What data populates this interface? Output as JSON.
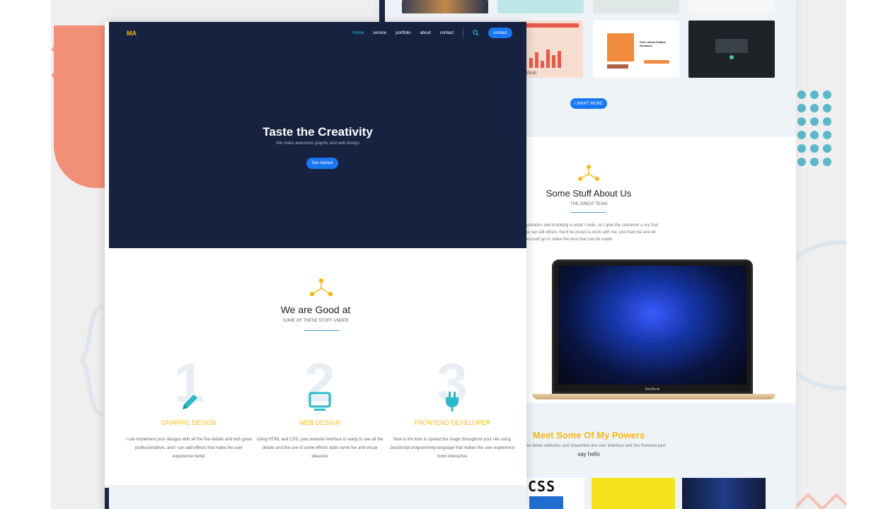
{
  "colors": {
    "navy": "#172240",
    "accent_blue": "#1877f2",
    "yellow": "#f5b915",
    "teal": "#2bb8c9",
    "coral": "#f28f77"
  },
  "back_page": {
    "thumbs": {
      "chair_title": "Full Limited Edition Sneakers",
      "price": "$478.00"
    },
    "want_more_label": "I WANT MORE",
    "about": {
      "title": "Some Stuff About Us",
      "subtitle": "THE GREAT TEAM",
      "text": "eputation and branding is what I seek, so I give the customer a ory that he can tell others You'll be proud to work with me, just mail me and let yourself go to make the best that can be made"
    },
    "laptop_label": "MacBook",
    "powers": {
      "title": "Meet Some Of My Powers",
      "subtitle": "make better websites and streamline the user interface and this frontend part.",
      "hello": "say hello"
    },
    "css_label": "CSS"
  },
  "front_page": {
    "logo": "MA",
    "nav": [
      "Home",
      "service",
      "portfolio",
      "about",
      "contact"
    ],
    "nav_button": "contact",
    "hero": {
      "title": "Taste the Creativity",
      "subtitle": "We make awesome graphic and web design",
      "button": "Get started"
    },
    "good_at": {
      "title": "We are Good at",
      "subtitle": "SOME OF THESE STUFF UNDER"
    },
    "services": [
      {
        "num": "1",
        "icon": "pencil-icon",
        "title": "GRAPHIC DESIGN",
        "text": "I can implement your designs with all the fine details and with great professionalism, and I can add effects that make the user experience better"
      },
      {
        "num": "2",
        "icon": "monitor-icon",
        "title": "WEB DESIGN",
        "text": "Using HTML and CSS, your website interface is ready to see all the details and the use of some effects adds some fun and visual pleasure"
      },
      {
        "num": "3",
        "icon": "plug-icon",
        "title": "FRONTEND DEVELOPER",
        "text": "Now is the time to spread the magic throughout your site using JavaScript programming language that makes the user experience more interactive"
      }
    ]
  }
}
